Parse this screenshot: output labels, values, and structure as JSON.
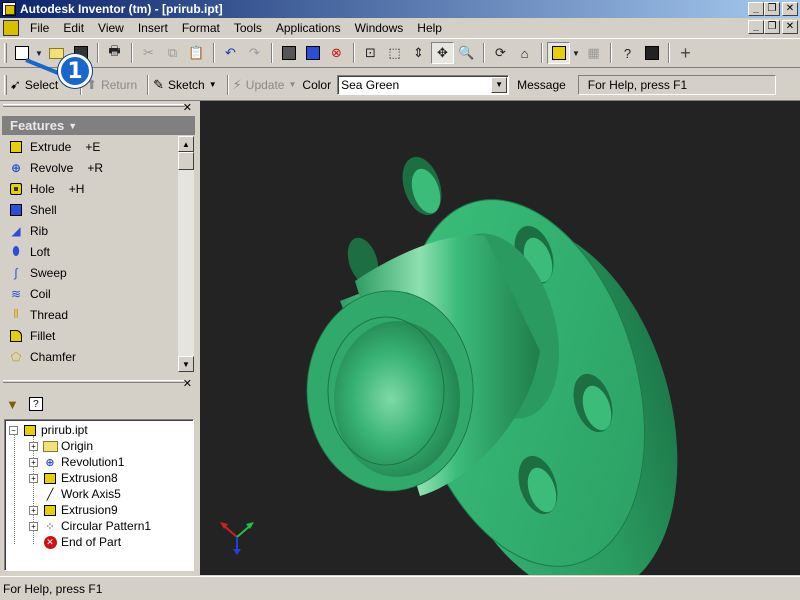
{
  "titlebar": {
    "title": "Autodesk Inventor (tm) - [prirub.ipt]"
  },
  "menu": {
    "items": [
      "File",
      "Edit",
      "View",
      "Insert",
      "Format",
      "Tools",
      "Applications",
      "Windows",
      "Help"
    ]
  },
  "toolbar2": {
    "select_label": "Select",
    "return_label": "Return",
    "sketch_label": "Sketch",
    "update_label": "Update",
    "color_label": "Color",
    "color_value": "Sea Green",
    "message_label": "Message",
    "message_value": "For Help, press F1"
  },
  "callout": {
    "number": "1"
  },
  "features": {
    "header": "Features",
    "items": [
      {
        "label": "Extrude",
        "hotkey": "+E",
        "icon": "extrude-icon"
      },
      {
        "label": "Revolve",
        "hotkey": "+R",
        "icon": "revolve-icon"
      },
      {
        "label": "Hole",
        "hotkey": "+H",
        "icon": "hole-icon"
      },
      {
        "label": "Shell",
        "hotkey": "",
        "icon": "shell-icon"
      },
      {
        "label": "Rib",
        "hotkey": "",
        "icon": "rib-icon"
      },
      {
        "label": "Loft",
        "hotkey": "",
        "icon": "loft-icon"
      },
      {
        "label": "Sweep",
        "hotkey": "",
        "icon": "sweep-icon"
      },
      {
        "label": "Coil",
        "hotkey": "",
        "icon": "coil-icon"
      },
      {
        "label": "Thread",
        "hotkey": "",
        "icon": "thread-icon"
      },
      {
        "label": "Fillet",
        "hotkey": "",
        "icon": "fillet-icon"
      },
      {
        "label": "Chamfer",
        "hotkey": "",
        "icon": "chamfer-icon"
      }
    ]
  },
  "browser": {
    "root": "prirub.ipt",
    "nodes": [
      "Origin",
      "Revolution1",
      "Extrusion8",
      "Work Axis5",
      "Extrusion9",
      "Circular Pattern1",
      "End of Part"
    ]
  },
  "model": {
    "color": "#2fae6a"
  },
  "status": {
    "text": "For Help, press F1"
  }
}
